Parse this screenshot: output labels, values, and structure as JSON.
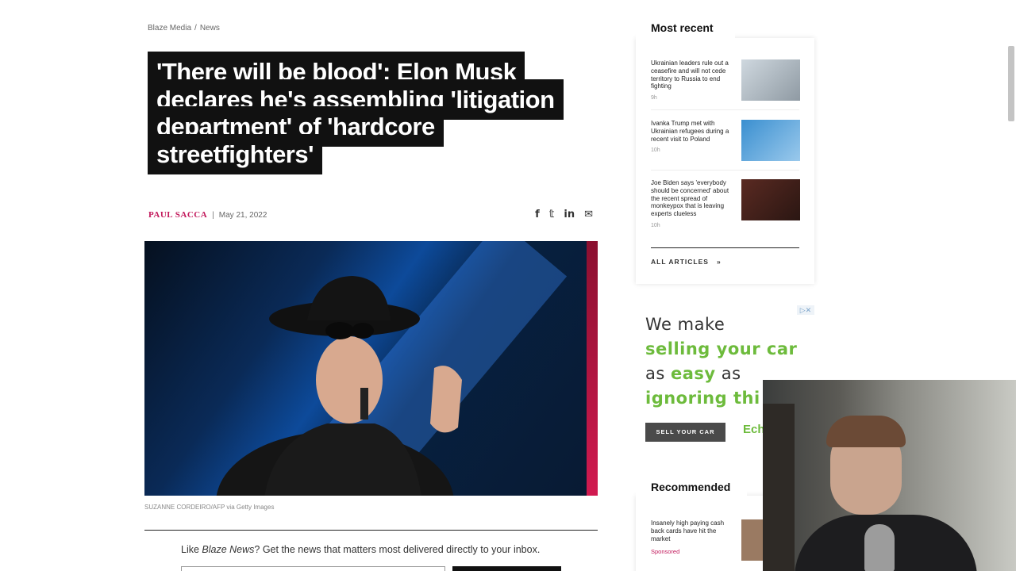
{
  "breadcrumb": {
    "root": "Blaze Media",
    "separator": "/",
    "section": "News"
  },
  "article": {
    "headline": "'There will be blood': Elon Musk declares he's assembling 'litigation department' of 'hardcore streetfighters'",
    "author": "PAUL SACCA",
    "separator": "|",
    "date": "May 21, 2022",
    "share_icons": {
      "facebook": "f",
      "twitter": "𝕥",
      "linkedin": "in",
      "email": "✉"
    },
    "image_caption": "SUZANNE CORDEIRO/AFP via Getty Images",
    "newsletter_prefix": "Like ",
    "newsletter_brand": "Blaze News",
    "newsletter_suffix": "? Get the news that matters most delivered directly to your inbox."
  },
  "sidebar": {
    "most_recent_title": "Most recent",
    "items": [
      {
        "title": "Ukrainian leaders rule out a ceasefire and will not cede territory to Russia to end fighting",
        "ago": "9h"
      },
      {
        "title": "Ivanka Trump met with Ukrainian refugees during a recent visit to Poland",
        "ago": "10h"
      },
      {
        "title": "Joe Biden says 'everybody should be concerned' about the recent spread of monkeypox that is leaving experts clueless",
        "ago": "10h"
      }
    ],
    "all_articles": "ALL ARTICLES",
    "all_articles_icon": "»"
  },
  "ad": {
    "line1": "We make",
    "line2": "selling your car",
    "line3_a": "as ",
    "line3_b": "easy",
    "line3_c": " as",
    "line4": "ignoring thi",
    "button": "SELL YOUR CAR",
    "brand": "Ech",
    "close": "▷✕"
  },
  "recommended": {
    "title": "Recommended",
    "item": "Insanely high paying cash back cards have hit the market",
    "sponsored": "Sponsored"
  },
  "colors": {
    "author": "#c2185b",
    "ad_green": "#6dbb3c"
  }
}
